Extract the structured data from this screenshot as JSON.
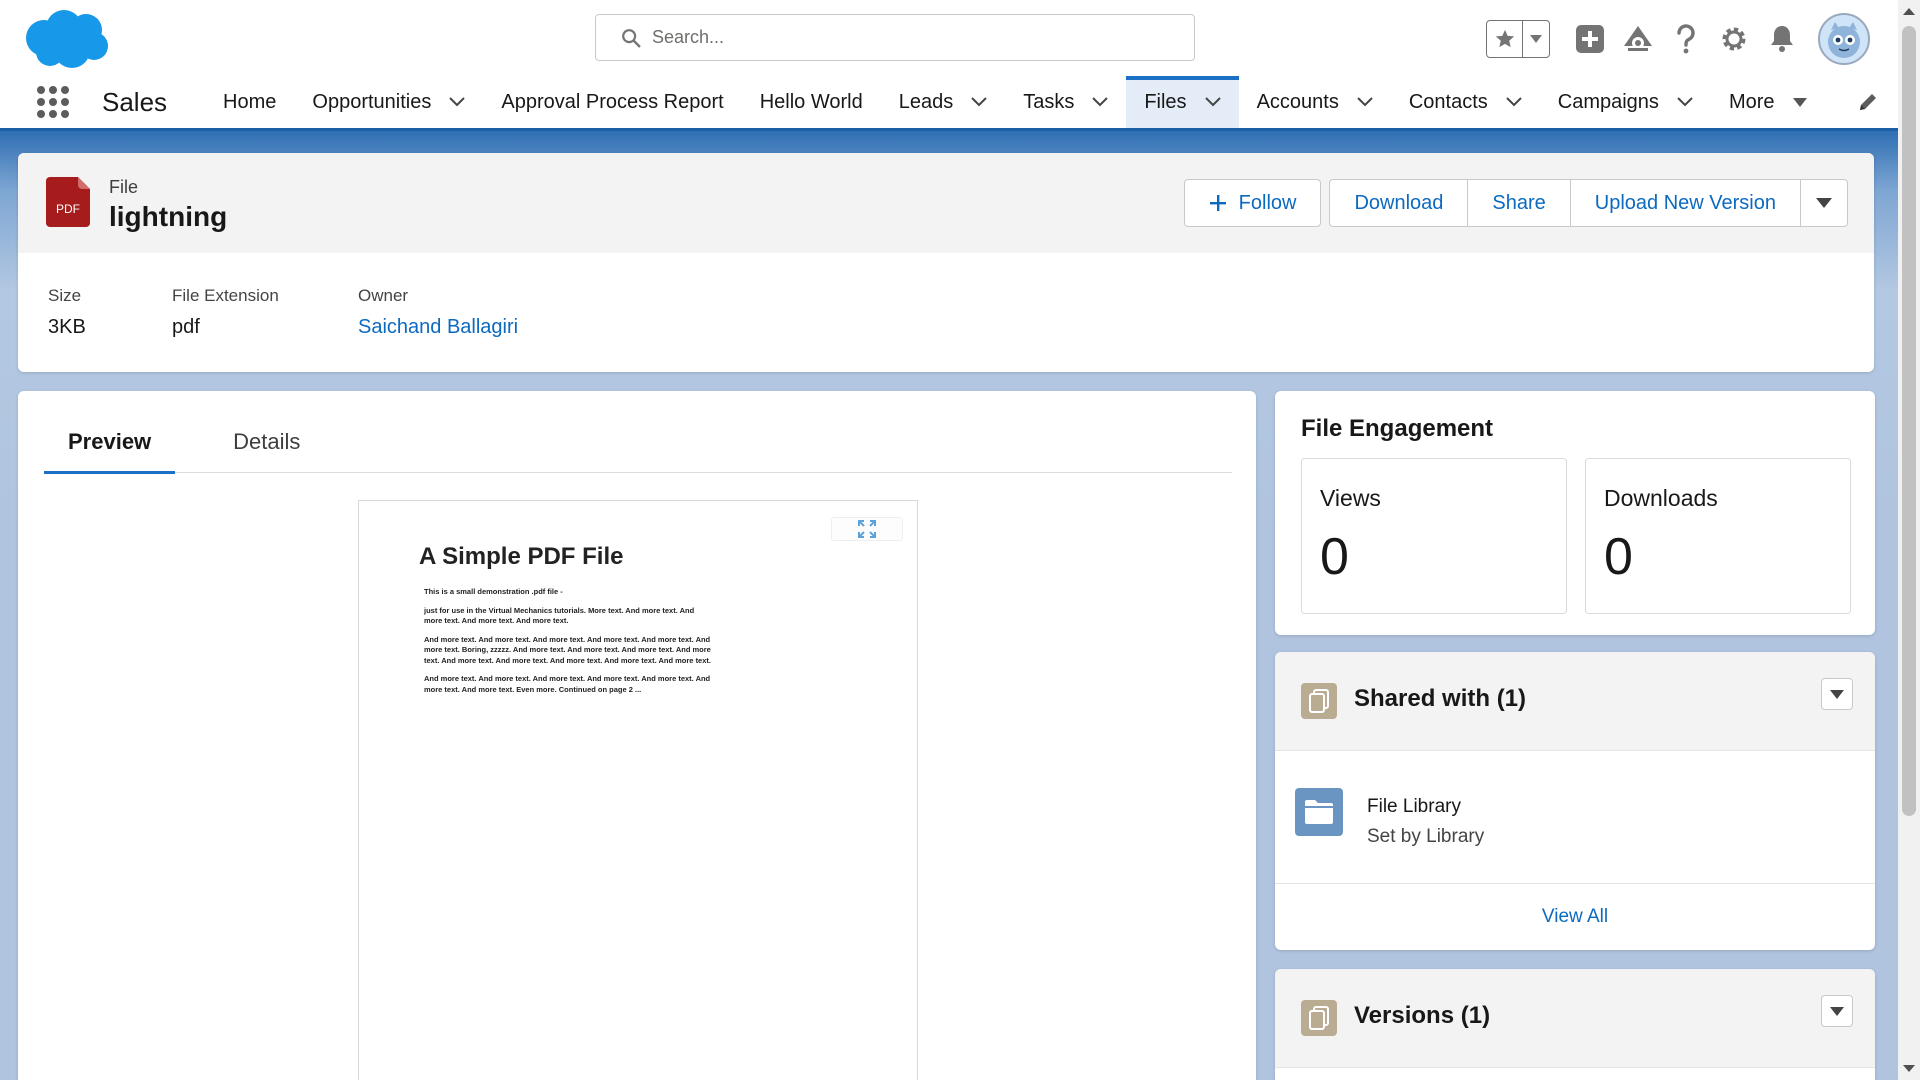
{
  "header": {
    "search_placeholder": "Search...",
    "icons": [
      "cloud-logo",
      "search-icon",
      "star-icon",
      "chevron-down-icon",
      "plus-icon",
      "trailhead-icon",
      "help-icon",
      "gear-icon",
      "bell-icon",
      "avatar"
    ]
  },
  "nav": {
    "app_name": "Sales",
    "items": [
      {
        "label": "Home",
        "has_menu": false
      },
      {
        "label": "Opportunities",
        "has_menu": true
      },
      {
        "label": "Approval Process Report",
        "has_menu": false
      },
      {
        "label": "Hello World",
        "has_menu": false
      },
      {
        "label": "Leads",
        "has_menu": true
      },
      {
        "label": "Tasks",
        "has_menu": true
      },
      {
        "label": "Files",
        "has_menu": true,
        "active": true
      },
      {
        "label": "Accounts",
        "has_menu": true
      },
      {
        "label": "Contacts",
        "has_menu": true
      },
      {
        "label": "Campaigns",
        "has_menu": true
      },
      {
        "label": "More",
        "has_menu": true
      }
    ]
  },
  "record": {
    "object_type": "File",
    "name": "lightning",
    "icon_label": "PDF",
    "actions": {
      "follow": "Follow",
      "download": "Download",
      "share": "Share",
      "upload": "Upload New Version"
    },
    "fields": [
      {
        "label": "Size",
        "value": "3KB",
        "is_link": false
      },
      {
        "label": "File Extension",
        "value": "pdf",
        "is_link": false
      },
      {
        "label": "Owner",
        "value": "Saichand Ballagiri",
        "is_link": true
      }
    ]
  },
  "preview": {
    "tabs": [
      {
        "label": "Preview",
        "active": true
      },
      {
        "label": "Details",
        "active": false
      }
    ],
    "pdf": {
      "title": "A Simple PDF File",
      "paragraphs": [
        "This is a small demonstration .pdf file -",
        "just for use in the Virtual Mechanics tutorials. More text. And more text. And more text. And more text. And more text.",
        "And more text. And more text. And more text. And more text. And more text. And more text. Boring, zzzzz. And more text. And more text. And more text. And more text. And more text. And more text. And more text. And more text. And more text.",
        "And more text. And more text. And more text. And more text. And more text. And more text. And more text. Even more. Continued on page 2 ..."
      ]
    }
  },
  "engagement": {
    "title": "File Engagement",
    "views_label": "Views",
    "views_value": "0",
    "downloads_label": "Downloads",
    "downloads_value": "0"
  },
  "shared": {
    "title": "Shared with (1)",
    "item_name": "File Library",
    "item_sub": "Set by Library",
    "view_all": "View All"
  },
  "versions": {
    "title": "Versions (1)"
  },
  "colors": {
    "brand_blue": "#0b6ac0",
    "nav_active_bar": "#1b6fc5",
    "pdf_icon": "#a61b1b",
    "card_icon": "#baac93",
    "library_icon": "#6a95c2"
  }
}
